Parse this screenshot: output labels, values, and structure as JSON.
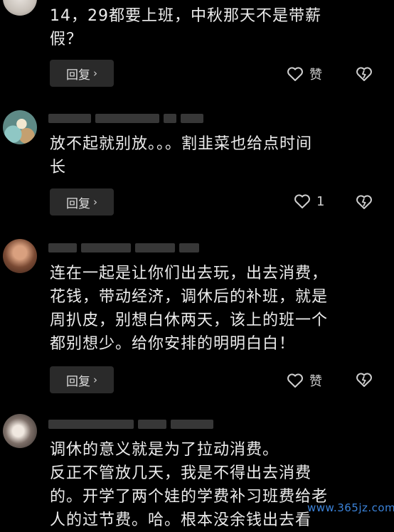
{
  "comments": [
    {
      "text_lines": [
        "14，29都要上班，中秋那天不是带薪",
        "假？"
      ],
      "reply_label": "回复",
      "like_label": "赞"
    },
    {
      "text_lines": [
        "放不起就别放。。。割韭菜也给点时间",
        "长"
      ],
      "reply_label": "回复",
      "like_label": "1"
    },
    {
      "text_lines": [
        "连在一起是让你们出去玩，出去消费，",
        "花钱，带动经济，调休后的补班，就是",
        "周扒皮，别想白休两天，该上的班一个",
        "都别想少。给你安排的明明白白！"
      ],
      "reply_label": "回复",
      "like_label": "赞"
    },
    {
      "text_lines": [
        "调休的意义就是为了拉动消费。",
        "反正不管放几天，我是不得出去消费",
        "的。开学了两个娃的学费补习班费给老",
        "人的过节费。哈。根本没余钱出去看"
      ]
    }
  ],
  "icons": {
    "heart": "heart-outline-icon",
    "dislike": "broken-heart-icon",
    "chevron": "chevron-right-icon"
  },
  "watermark": "www.365jz.com",
  "colors": {
    "background": "#000000",
    "text": "#ececec",
    "button_bg": "#2a2a2a",
    "watermark": "#3b82d8"
  }
}
